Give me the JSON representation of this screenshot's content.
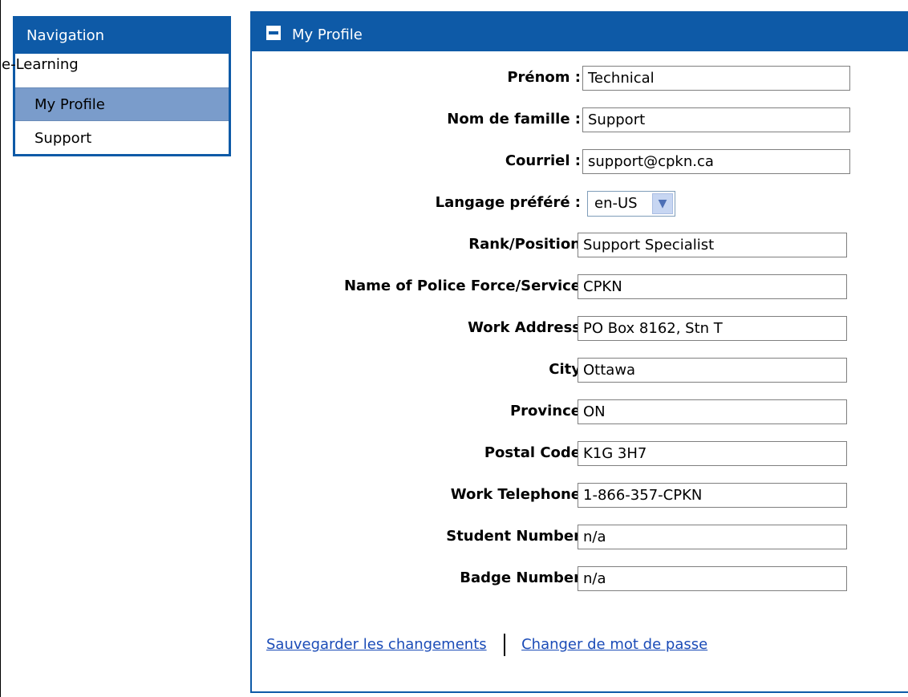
{
  "navigation": {
    "title": "Navigation",
    "section": "e-Learning",
    "items": [
      {
        "label": "My Profile",
        "selected": true
      },
      {
        "label": "Support",
        "selected": false
      }
    ]
  },
  "profile": {
    "title": "My Profile",
    "fields": [
      {
        "label": "Prénom :",
        "value": "Technical"
      },
      {
        "label": "Nom de famille :",
        "value": "Support"
      },
      {
        "label": "Courriel :",
        "value": "support@cpkn.ca"
      },
      {
        "label": "Langage préféré :",
        "value": "en-US"
      },
      {
        "label": "Rank/Position",
        "value": "Support Specialist"
      },
      {
        "label": "Name of Police Force/Service",
        "value": "CPKN"
      },
      {
        "label": "Work Address",
        "value": "PO Box 8162, Stn T"
      },
      {
        "label": "City",
        "value": "Ottawa"
      },
      {
        "label": "Province",
        "value": "ON"
      },
      {
        "label": "Postal Code",
        "value": "K1G 3H7"
      },
      {
        "label": "Work Telephone",
        "value": "1-866-357-CPKN"
      },
      {
        "label": "Student Number",
        "value": "n/a"
      },
      {
        "label": "Badge Number",
        "value": "n/a"
      }
    ],
    "actions": {
      "save": "Sauvegarder les changements",
      "change_password": "Changer de mot de passe"
    }
  },
  "colors": {
    "header_blue": "#0e5aa7",
    "selected_item": "#7a9ccb",
    "link": "#1a4bb7"
  }
}
